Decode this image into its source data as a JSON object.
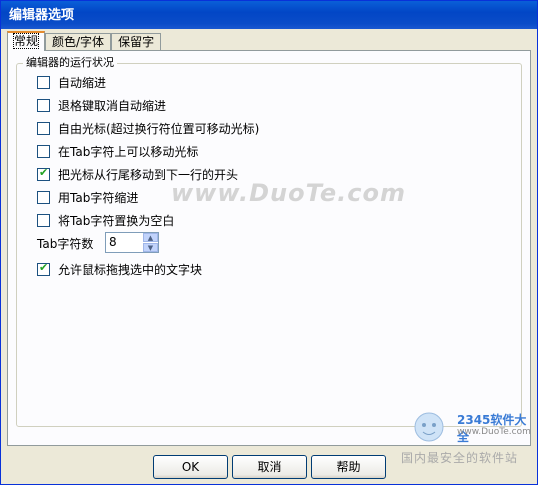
{
  "window": {
    "title": "编辑器选项"
  },
  "tabs": [
    {
      "label": "常规",
      "active": true
    },
    {
      "label": "颜色/字体",
      "active": false
    },
    {
      "label": "保留字",
      "active": false
    }
  ],
  "group": {
    "title": "编辑器的运行状况",
    "options": [
      {
        "label": "自动缩进",
        "checked": false
      },
      {
        "label": "退格键取消自动缩进",
        "checked": false
      },
      {
        "label": "自由光标(超过换行符位置可移动光标)",
        "checked": false
      },
      {
        "label": "在Tab字符上可以移动光标",
        "checked": false
      },
      {
        "label": "把光标从行尾移动到下一行的开头",
        "checked": true
      },
      {
        "label": "用Tab字符缩进",
        "checked": false
      },
      {
        "label": "将Tab字符置换为空白",
        "checked": false
      }
    ],
    "tab_size": {
      "label": "Tab字符数",
      "value": "8"
    },
    "drag_option": {
      "label": "允许鼠标拖拽选中的文字块",
      "checked": true
    }
  },
  "watermark": {
    "text": "www.DuoTe.com",
    "brand": "2345软件大全",
    "url": "www.DuoTe.com",
    "slogan": "国内最安全的软件站"
  },
  "buttons": {
    "ok": "OK",
    "cancel": "取消",
    "help": "帮助"
  },
  "colors": {
    "titlebar": "#0a4cc8",
    "tab_accent": "#e68b2c",
    "checkmark": "#21a121"
  }
}
